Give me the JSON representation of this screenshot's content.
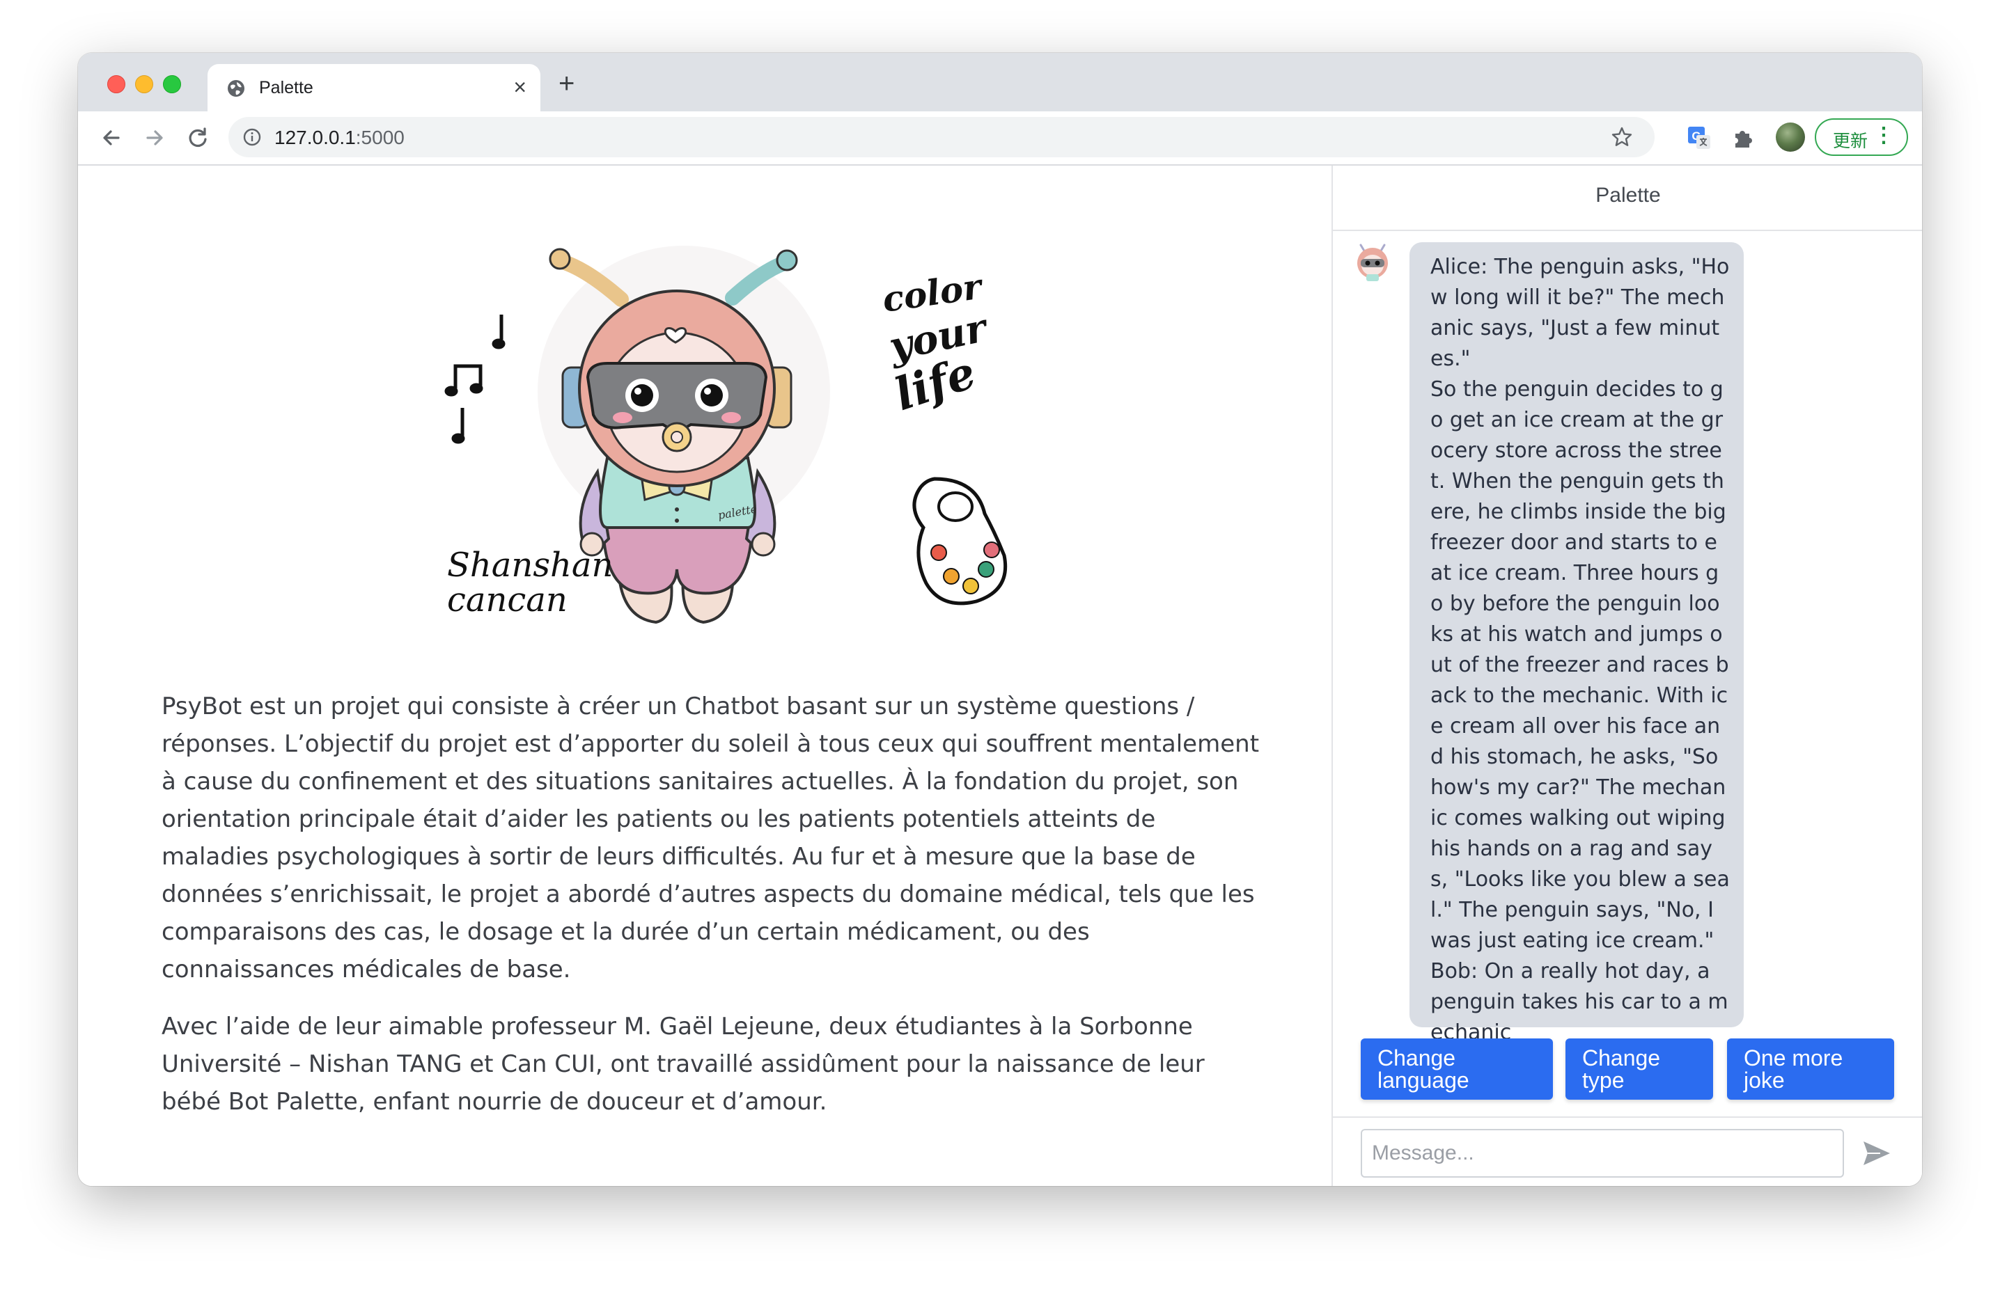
{
  "browser": {
    "tab_title": "Palette",
    "new_tab_label": "+",
    "close_label": "×",
    "url_host": "127.0.0.1",
    "url_port": ":5000",
    "update_label": "更新"
  },
  "hero": {
    "handwriting_left_1": "Shanshan",
    "handwriting_left_2": "cancan",
    "handwriting_right_1": "color",
    "handwriting_right_2": "your",
    "handwriting_right_3": "life",
    "shirt_text": "palette"
  },
  "main": {
    "paragraph_1": "PsyBot est un projet qui consiste à créer un Chatbot basant sur un système questions / réponses. L’objectif du projet est d’apporter du soleil à tous ceux qui souffrent mentalement à cause du confinement et des situations sanitaires actuelles. À la fondation du projet, son orientation principale était d’aider les patients ou les patients potentiels atteints de maladies psychologiques à sortir de leurs difficultés. Au fur et à mesure que la base de données s’enrichissait, le projet a abordé d’autres aspects du domaine médical, tels que les comparaisons des cas, le dosage et la durée d’un certain médicament, ou des connaissances médicales de base.",
    "paragraph_2": "Avec l’aide de leur aimable professeur M. Gaël Lejeune, deux étudiantes à la Sorbonne Université – Nishan TANG et Can CUI, ont travaillé assidûment pour la naissance de leur bébé Bot Palette, enfant nourrie de douceur et d’amour."
  },
  "chat": {
    "title": "Palette",
    "bot_message": "Alice: The penguin asks, \"How long will it be?\" The mechanic says, \"Just a few minutes.\"\nSo the penguin decides to go get an ice cream at the grocery store across the street. When the penguin gets there, he climbs inside the big freezer door and starts to eat ice cream. Three hours go by before the penguin looks at his watch and jumps out of the freezer and races back to the mechanic. With ice cream all over his face and his stomach, he asks, \"So how's my car?\" The mechanic comes walking out wiping his hands on a rag and says, \"Looks like you blew a seal.\" The penguin says, \"No, I was just eating ice cream.\" Bob: On a really hot day, a penguin takes his car to a mechanic",
    "quick_replies": [
      "Change language",
      "Change type",
      "One more joke"
    ],
    "input_placeholder": "Message..."
  },
  "colors": {
    "accent": "#2b6cf0",
    "bubble": "#d9dde4",
    "update_green": "#34a853"
  },
  "icons": [
    "globe-icon",
    "close-icon",
    "back-icon",
    "forward-icon",
    "reload-icon",
    "info-icon",
    "star-icon",
    "translate-icon",
    "extensions-icon",
    "more-icon",
    "send-icon"
  ]
}
